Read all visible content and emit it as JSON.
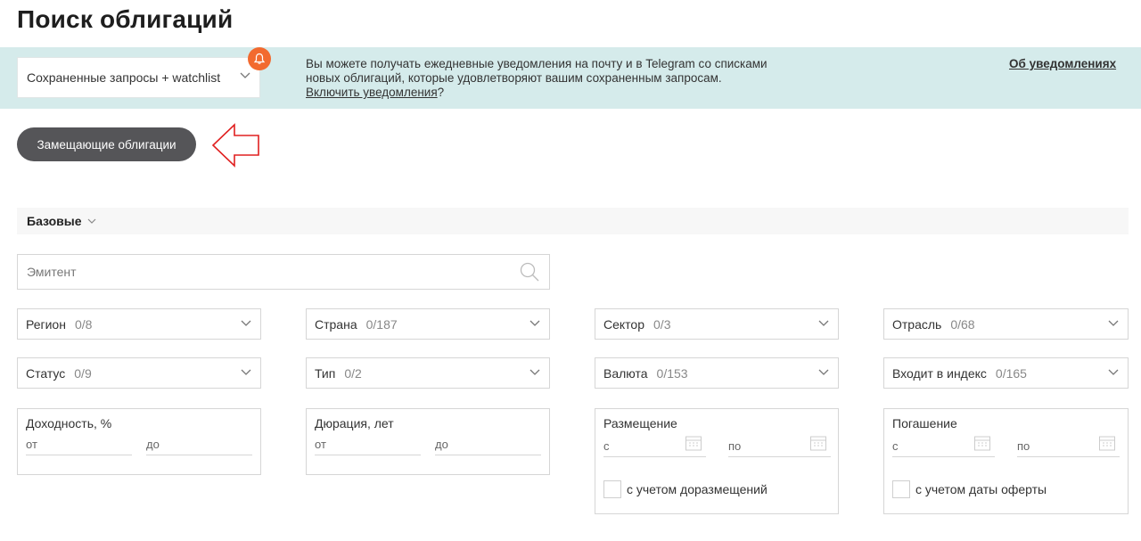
{
  "title": "Поиск облигаций",
  "notifications": {
    "saved_select": "Сохраненные запросы + watchlist",
    "text_line1": "Вы можете получать ежедневные уведомления на почту и в Telegram со списками",
    "text_line2": "новых облигаций, которые удовлетворяют вашим сохраненным запросам.",
    "enable_link": "Включить уведомления",
    "enable_suffix": "?",
    "about_link": "Об уведомлениях",
    "bell_color": "#f26a2f",
    "banner_color": "#d5ebeb"
  },
  "replacement_button": "Замещающие облигации",
  "section": {
    "label": "Базовые"
  },
  "issuer": {
    "placeholder": "Эмитент"
  },
  "filters": {
    "region": {
      "label": "Регион",
      "count": "0/8"
    },
    "country": {
      "label": "Страна",
      "count": "0/187"
    },
    "sector": {
      "label": "Сектор",
      "count": "0/3"
    },
    "industry": {
      "label": "Отрасль",
      "count": "0/68"
    },
    "status": {
      "label": "Статус",
      "count": "0/9"
    },
    "type": {
      "label": "Тип",
      "count": "0/2"
    },
    "currency": {
      "label": "Валюта",
      "count": "0/153"
    },
    "index": {
      "label": "Входит в индекс",
      "count": "0/165"
    }
  },
  "ranges": {
    "yield": {
      "label": "Доходность, %",
      "from": "от",
      "to": "до"
    },
    "duration": {
      "label": "Дюрация, лет",
      "from": "от",
      "to": "до"
    },
    "placement": {
      "label": "Размещение",
      "from": "с",
      "to": "по",
      "checkbox": "с учетом доразмещений"
    },
    "maturity": {
      "label": "Погашение",
      "from": "с",
      "to": "по",
      "checkbox": "с учетом даты оферты"
    }
  }
}
